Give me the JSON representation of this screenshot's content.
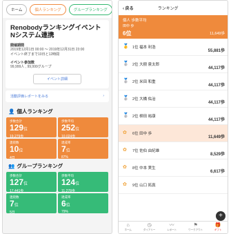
{
  "left": {
    "tabs": [
      "ホーム",
      "個人ランキング",
      "グループランキング"
    ],
    "event": {
      "title": "Renobodyランキングイベント Nシステム連携",
      "period_label": "開催期間",
      "period": "2019年12月1日 00:00 〜 2019年12月31日 23:00",
      "status": "イベント終了まで10日と12時間",
      "participants_label": "イベント参加数",
      "participants": "99,999人 , 99,999グループ",
      "detail_button": "イベント詳細"
    },
    "report_link": "活動評価レポートをみる",
    "personal": {
      "title": "個人ランキング",
      "tiles": [
        {
          "label": "歩数合計",
          "rank": "129",
          "unit": "位",
          "value": "19,279歩"
        },
        {
          "label": "歩数平均",
          "rank": "252",
          "unit": "位",
          "value": "10,024歩"
        },
        {
          "label": "連続数",
          "rank": "10",
          "unit": "位",
          "value": "4日"
        },
        {
          "label": "達成率",
          "rank": "7",
          "unit": "位",
          "value": "87%"
        }
      ]
    },
    "group": {
      "title": "グループランキング",
      "tiles": [
        {
          "label": "歩数合計",
          "rank": "127",
          "unit": "位",
          "value": "17,441歩"
        },
        {
          "label": "歩数平均",
          "rank": "124",
          "unit": "位",
          "value": "11,278歩"
        },
        {
          "label": "連続数",
          "rank": "7",
          "unit": "位",
          "value": "5日"
        },
        {
          "label": "達成率",
          "rank": "6",
          "unit": "位",
          "value": "79%"
        }
      ]
    }
  },
  "right": {
    "back": "戻る",
    "title": "ランキング",
    "header": {
      "line1": "個人 歩数平均",
      "line2": "田中 歩",
      "rank": "6位",
      "steps": "11,649歩"
    },
    "rows": [
      {
        "medal": "🥇",
        "name": "1位 福本 利浩",
        "steps": "55,881歩",
        "hl": false
      },
      {
        "medal": "🥈",
        "name": "2位 大樹 泉太郎",
        "steps": "44,117歩",
        "hl": false
      },
      {
        "medal": "🥈",
        "name": "2位 米田 和重",
        "steps": "44,117歩",
        "hl": false
      },
      {
        "medal": "🥈",
        "name": "2位 大橋 佑治",
        "steps": "44,117歩",
        "hl": false
      },
      {
        "medal": "🥈",
        "name": "2位 柳田 裕康",
        "steps": "44,117歩",
        "hl": false
      },
      {
        "medal": "✿",
        "name": "6位 田中 歩",
        "steps": "11,649歩",
        "hl": true
      },
      {
        "medal": "✿",
        "name": "7位 佐伯 由紀雄",
        "steps": "8,529歩",
        "hl": false
      },
      {
        "medal": "✿",
        "name": "8位 中本 実生",
        "steps": "6,617歩",
        "hl": false
      },
      {
        "medal": "✿",
        "name": "9位 山口 拓真",
        "steps": "",
        "hl": false
      }
    ],
    "bottom_nav": [
      "ホーム",
      "ダイアリー",
      "レポート",
      "ワークアウト",
      "ギフト"
    ]
  }
}
